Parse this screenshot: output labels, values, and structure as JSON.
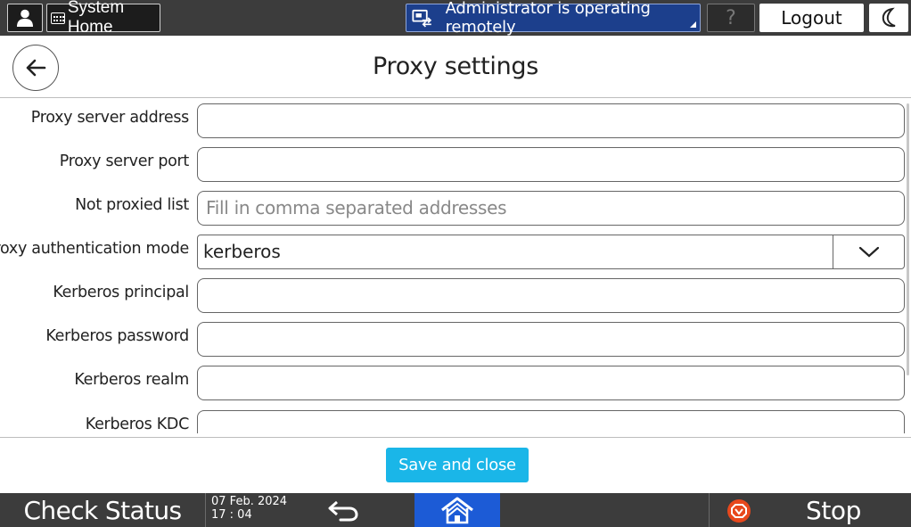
{
  "topbar": {
    "system_home_label": "System Home",
    "remote_status_label": "Administrator is operating remotely",
    "help_label": "?",
    "logout_label": "Logout"
  },
  "header": {
    "title": "Proxy settings"
  },
  "form": {
    "fields": [
      {
        "label": "Proxy server address",
        "value": "",
        "placeholder": ""
      },
      {
        "label": "Proxy server port",
        "value": "",
        "placeholder": ""
      },
      {
        "label": "Not proxied list",
        "value": "",
        "placeholder": "Fill in comma separated addresses"
      },
      {
        "label": "Proxy authentication mode",
        "value": "kerberos"
      },
      {
        "label": "Kerberos principal",
        "value": "",
        "placeholder": ""
      },
      {
        "label": "Kerberos password",
        "value": "",
        "placeholder": ""
      },
      {
        "label": "Kerberos realm",
        "value": "",
        "placeholder": ""
      },
      {
        "label": "Kerberos KDC",
        "value": "",
        "placeholder": ""
      }
    ]
  },
  "actions": {
    "save_label": "Save and close"
  },
  "bottombar": {
    "check_status_label": "Check Status",
    "date": "07 Feb. 2024",
    "time": "17 : 04",
    "stop_label": "Stop"
  },
  "colors": {
    "bar_bg": "#3c3c3c",
    "remote_bg": "#1c3f8c",
    "save_bg": "#1ab6e8",
    "home_bg": "#1c5bd6",
    "stop_icon": "#e8481c"
  }
}
